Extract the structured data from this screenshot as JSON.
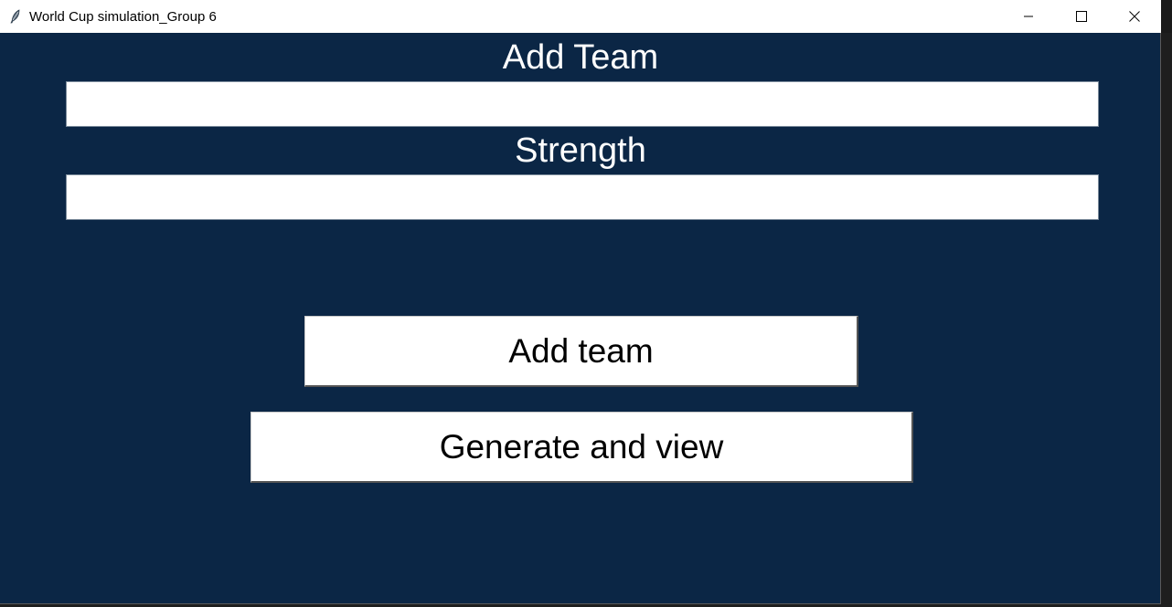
{
  "window": {
    "title": "World Cup simulation_Group 6",
    "icon": "feather-icon",
    "background": "#0b2645"
  },
  "form": {
    "team_label": "Add Team",
    "team_value": "",
    "strength_label": "Strength",
    "strength_value": ""
  },
  "actions": {
    "add_team_label": "Add team",
    "generate_label": "Generate and view"
  }
}
